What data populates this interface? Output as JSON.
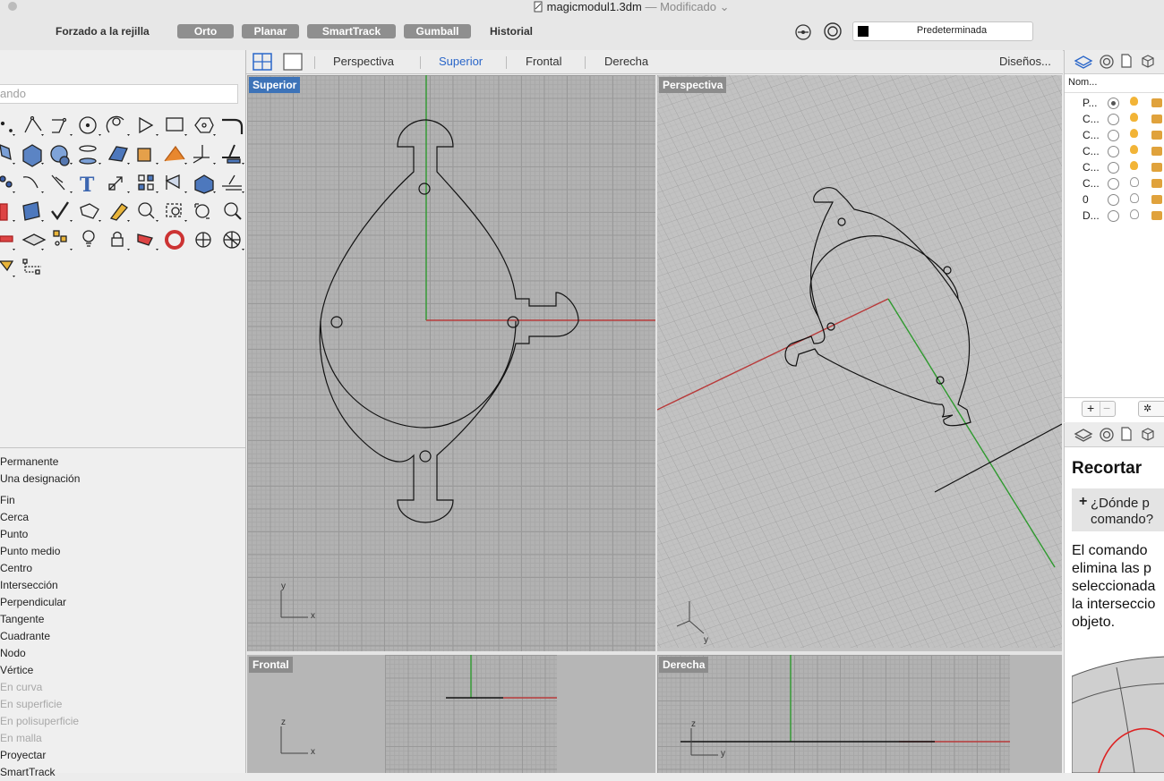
{
  "window": {
    "filename": "magicmodul1.3dm",
    "status": "— Modificado"
  },
  "toolbar": {
    "grid_snap": "Forzado a la rejilla",
    "ortho": "Orto",
    "planar": "Planar",
    "smarttrack": "SmartTrack",
    "gumball": "Gumball",
    "history": "Historial",
    "layer": "Predeterminada"
  },
  "left_panel": {
    "command_placeholder": "ando",
    "osnap_items": [
      {
        "label": "Permanente",
        "enabled": true
      },
      {
        "label": "Una designación",
        "enabled": true
      },
      {
        "label": "Fin",
        "enabled": true
      },
      {
        "label": "Cerca",
        "enabled": true
      },
      {
        "label": "Punto",
        "enabled": true
      },
      {
        "label": "Punto medio",
        "enabled": true
      },
      {
        "label": "Centro",
        "enabled": true
      },
      {
        "label": "Intersección",
        "enabled": true
      },
      {
        "label": "Perpendicular",
        "enabled": true
      },
      {
        "label": "Tangente",
        "enabled": true
      },
      {
        "label": "Cuadrante",
        "enabled": true
      },
      {
        "label": "Nodo",
        "enabled": true
      },
      {
        "label": "Vértice",
        "enabled": true
      },
      {
        "label": "En curva",
        "enabled": false
      },
      {
        "label": "En superficie",
        "enabled": false
      },
      {
        "label": "En polisuperficie",
        "enabled": false
      },
      {
        "label": "En malla",
        "enabled": false
      },
      {
        "label": "Proyectar",
        "enabled": true
      },
      {
        "label": "SmartTrack",
        "enabled": true
      }
    ]
  },
  "viewport_tabs": {
    "perspective": "Perspectiva",
    "top": "Superior",
    "front": "Frontal",
    "right": "Derecha",
    "layouts": "Diseños..."
  },
  "viewports": {
    "top_label": "Superior",
    "perspective_label": "Perspectiva",
    "front_label": "Frontal",
    "right_label": "Derecha"
  },
  "axes": {
    "x": "x",
    "y": "y",
    "z": "z"
  },
  "layers": {
    "header": "Nom...",
    "rows": [
      {
        "name": "P...",
        "current": true,
        "light_on": true
      },
      {
        "name": "C...",
        "current": false,
        "light_on": true
      },
      {
        "name": "C...",
        "current": false,
        "light_on": true
      },
      {
        "name": "C...",
        "current": false,
        "light_on": true
      },
      {
        "name": "C...",
        "current": false,
        "light_on": true
      },
      {
        "name": "C...",
        "current": false,
        "light_on": false
      },
      {
        "name": "0",
        "current": false,
        "light_on": false
      },
      {
        "name": "D...",
        "current": false,
        "light_on": false
      }
    ],
    "add": "+",
    "remove": "−"
  },
  "help": {
    "title": "Recortar",
    "box_plus": "+",
    "box_line1": "¿Dónde p",
    "box_line2": "comando?",
    "body": [
      "El comando",
      "elimina las p",
      "seleccionada",
      "la interseccio",
      "objeto."
    ]
  },
  "colors": {
    "accent": "#2a66c9",
    "x_axis": "#b83a3a",
    "y_axis": "#2e9a2e",
    "toggle": "#8f8f8f",
    "viewport_bg": "#b2b2b2"
  }
}
